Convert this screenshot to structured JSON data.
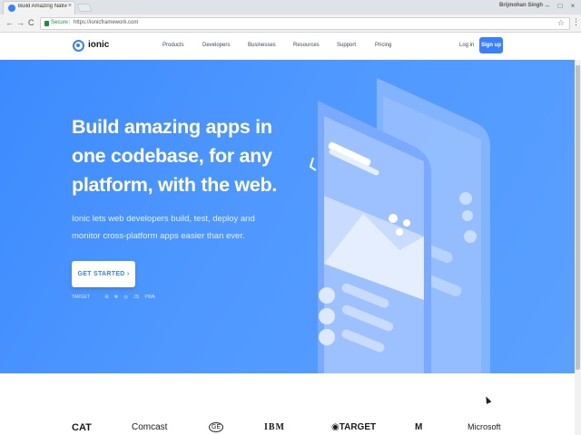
{
  "browser": {
    "tab_title": "Build Amazing Native Ap",
    "tab_close": "×",
    "profile": "Brijmohan Singh",
    "min": "–",
    "max": "□",
    "close": "×",
    "back": "←",
    "forward": "→",
    "reload": "C",
    "secure_label": "Secure",
    "url": "https://ionicframework.com",
    "star": "☆",
    "menu": "⋮"
  },
  "header": {
    "logo": "ionic",
    "nav": [
      "Products",
      "Developers",
      "Businesses",
      "Resources",
      "Support",
      "Pricing"
    ],
    "login": "Log in",
    "signup": "Sign up"
  },
  "hero": {
    "title_lines": [
      "Build amazing apps in",
      "one codebase, for any",
      "platform, with the web."
    ],
    "subtitle_lines": [
      "Ionic lets web developers build, test, deploy and",
      "monitor cross-platform apps easier than ever."
    ],
    "cta": "GET STARTED ›",
    "targets_label": "TARGET",
    "targets": [
      "",
      "",
      "⊞",
      "✻",
      "◎",
      "JS",
      "PWA"
    ]
  },
  "logos": [
    "CAT",
    "Comcast",
    "GE",
    "IBM",
    "◉TARGET",
    "M",
    "Microsoft"
  ],
  "colors": {
    "accent": "#3880ff",
    "hero_bg": "#4a92ff"
  }
}
